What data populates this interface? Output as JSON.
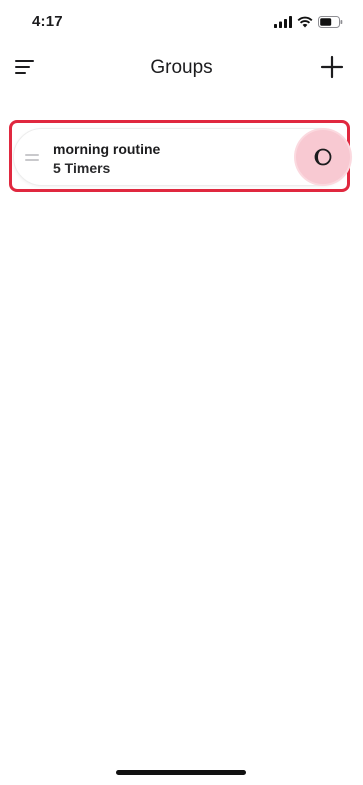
{
  "status_bar": {
    "time": "4:17"
  },
  "nav": {
    "title": "Groups"
  },
  "groups": [
    {
      "name": "morning routine",
      "count": "5 Timers"
    }
  ],
  "icons": {
    "menu": "menu-icon",
    "add": "plus-icon",
    "drag": "drag-handle-icon",
    "toggle": "half-moon-icon"
  },
  "colors": {
    "highlight": "#e0283f",
    "toggle_bg": "#f8c9d2"
  }
}
